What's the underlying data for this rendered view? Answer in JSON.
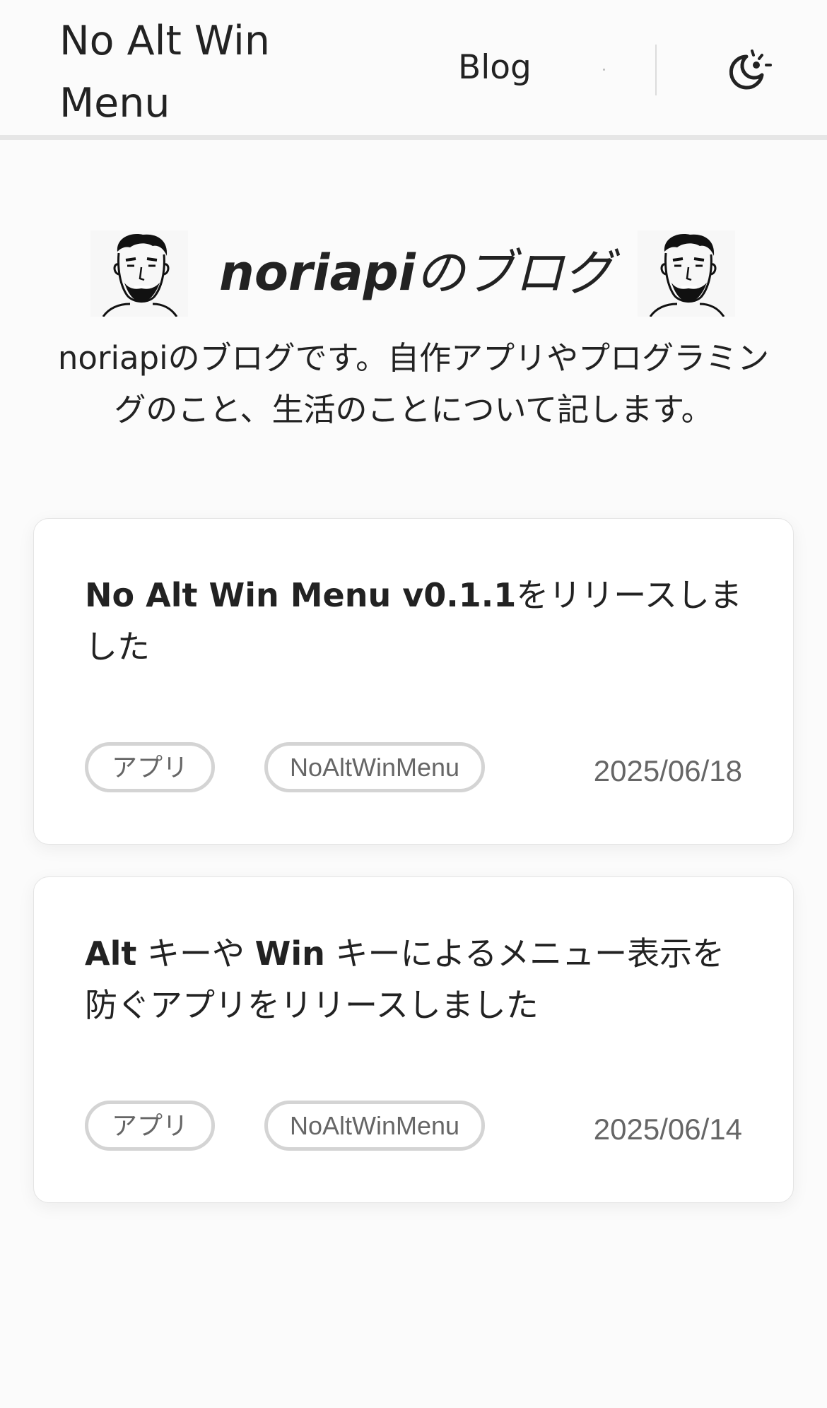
{
  "header": {
    "site_title": "No Alt Win Menu",
    "nav_blog": "Blog",
    "theme_toggle_icon": "moon-sun-icon"
  },
  "hero": {
    "title_latin": "noriapi",
    "title_jp": "のブログ",
    "avatar_icon": "sketch-face-avatar",
    "description": "noriapiのブログです。自作アプリやプログラミングのこと、生活のことについて記します。"
  },
  "posts": [
    {
      "title_bold": "No Alt Win Menu v0.1.1",
      "title_rest": "をリリースしました",
      "tags": [
        "アプリ",
        "NoAltWinMenu"
      ],
      "date": "2025/06/18"
    },
    {
      "title_parts": [
        {
          "bold": true,
          "text": "Alt"
        },
        {
          "bold": false,
          "text": " キーや "
        },
        {
          "bold": true,
          "text": "Win"
        },
        {
          "bold": false,
          "text": " キーによるメニュー表示を防ぐアプリをリリースしました"
        }
      ],
      "tags": [
        "アプリ",
        "NoAltWinMenu"
      ],
      "date": "2025/06/14"
    }
  ],
  "colors": {
    "background": "#fbfbfb",
    "card_background": "#ffffff",
    "text": "#222222",
    "muted_text": "#666666",
    "tag_border": "#d4d4d4",
    "header_rule": "#e6e6e6"
  }
}
